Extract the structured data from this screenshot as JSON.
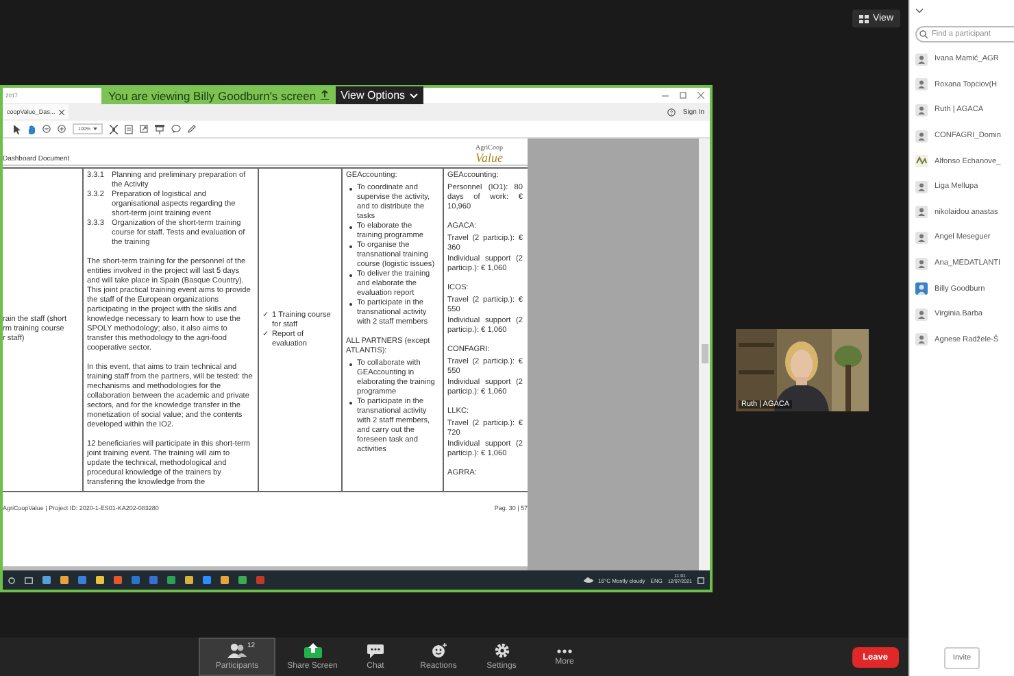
{
  "top_bar": {
    "view_button": "View"
  },
  "share_banner": {
    "text": "You are viewing Billy Goodburn's screen",
    "view_options": "View Options"
  },
  "shared_screen": {
    "window_title": "2017",
    "tab": "coopValue_Das...",
    "sign_in": "Sign In",
    "zoom_level": "100%",
    "document": {
      "section_title": "Dashboard Document",
      "logo": {
        "line_1": "AgriCoop",
        "line_2": "Value"
      },
      "column_1": [
        "rain the staff (short",
        "rm training course",
        "r staff)"
      ],
      "column_2": {
        "tasks": [
          {
            "number": "3.3.1",
            "text": "Planning and preliminary preparation of the Activity"
          },
          {
            "number": "3.3.2",
            "text": "Preparation of logistical and organisational aspects regarding the short-term joint training event"
          },
          {
            "number": "3.3.3",
            "text": "Organization of the short-term training course for staff. Tests and evaluation of the training"
          }
        ],
        "paragraphs": [
          "The short-term training for the personnel of the entities involved in the project will last 5 days and will take place in Spain (Basque Country). This joint practical training event aims to provide the staff of the European organizations participating in the project with the skills and knowledge necessary to learn how to use the SPOLY methodology; also, it also aims to transfer this methodology to the agri-food cooperative sector.",
          "In this event, that aims to train technical and training staff from the partners, will be tested: the mechanisms and methodologies for the collaboration between the academic and private sectors, and for the knowledge transfer in the monetization of social value; and the contents developed within the IO2.",
          "12 beneficiaries will participate in this short-term joint training event. The training will aim to update the technical, methodological and procedural knowledge of the trainers by transfering the knowledge from the"
        ]
      },
      "column_3": [
        {
          "mark": "✓",
          "text": "1 Training course for staff"
        },
        {
          "mark": "✓",
          "text": "Report of evaluation"
        }
      ],
      "column_4": [
        {
          "heading": "GEAccounting:",
          "bullets": [
            "To coordinate and supervise the activity, and to distribute the tasks",
            "To elaborate the training programme",
            "To organise the transnational training course (logistic issues)",
            "To deliver the training and elaborate the evaluation report",
            "To participate in the transnational activity with 2 staff members"
          ]
        },
        {
          "heading": "ALL PARTNERS (except ATLANTIS):",
          "bullets": [
            "To collaborate with GEAccounting in elaborating the training programme",
            "To participate in the transnational activity with 2 staff members, and carry out the foreseen task and activities"
          ]
        }
      ],
      "column_5": [
        {
          "heading": "GEAccounting:",
          "lines": [
            "Personnel (IO1): 80 days of work: € 10,960"
          ]
        },
        {
          "heading": "AGACA:",
          "lines": [
            "Travel (2 particip.): € 360",
            "Individual support (2 particip.): € 1,060"
          ]
        },
        {
          "heading": "ICOS:",
          "lines": [
            "Travel (2 particip.): € 550",
            "Individual support (2 particip.): € 1,060"
          ]
        },
        {
          "heading": "CONFAGRI:",
          "lines": [
            "Travel (2 particip.): € 550",
            "Individual support (2 particip.): € 1,060"
          ]
        },
        {
          "heading": "LLKC:",
          "lines": [
            "Travel (2 particip.): € 720",
            "Individual support (2 particip.): € 1,060"
          ]
        },
        {
          "heading": "AGRRA:"
        }
      ],
      "footer_left": "AgriCoopValue | Project ID: 2020-1-ES01-KA202-083280",
      "footer_right": "Pag. 30 | 57"
    },
    "taskbar": {
      "weather": "16°C Mostly cloudy",
      "language": "ENG",
      "time": "11:01",
      "date": "12/07/2021"
    }
  },
  "video": {
    "name": "Ruth | AGACA"
  },
  "toolbar": {
    "buttons": [
      {
        "kind": "participants",
        "label": "Participants",
        "count": "12",
        "selected": true
      },
      {
        "kind": "share",
        "label": "Share Screen",
        "selected": false
      },
      {
        "kind": "chat",
        "label": "Chat",
        "selected": false
      },
      {
        "kind": "reactions",
        "label": "Reactions",
        "selected": false
      },
      {
        "kind": "settings",
        "label": "Settings",
        "selected": false
      },
      {
        "kind": "more",
        "label": "More",
        "selected": false
      }
    ],
    "leave": "Leave"
  },
  "participants": {
    "search_placeholder": "Find a participant",
    "people": [
      {
        "name": "Ivana Mamić_AGR",
        "kind": "default"
      },
      {
        "name": "Roxana Topciov(H",
        "kind": "default"
      },
      {
        "name": "Ruth | AGACA",
        "kind": "default"
      },
      {
        "name": "CONFAGRI_Domin",
        "kind": "default"
      },
      {
        "name": "Alfonso Echanove_",
        "kind": "logo"
      },
      {
        "name": "Liga Mellupa",
        "kind": "default"
      },
      {
        "name": "nikolaidou anastas",
        "kind": "default"
      },
      {
        "name": "Angel Meseguer",
        "kind": "default"
      },
      {
        "name": "Ana_MEDATLANTI",
        "kind": "default"
      },
      {
        "name": "Billy Goodburn"
      },
      {
        "name": "Virginia.Barba",
        "kind": "default"
      },
      {
        "name": "Agnese Radžele-Š",
        "kind": "default"
      }
    ],
    "invite": "Invite"
  }
}
